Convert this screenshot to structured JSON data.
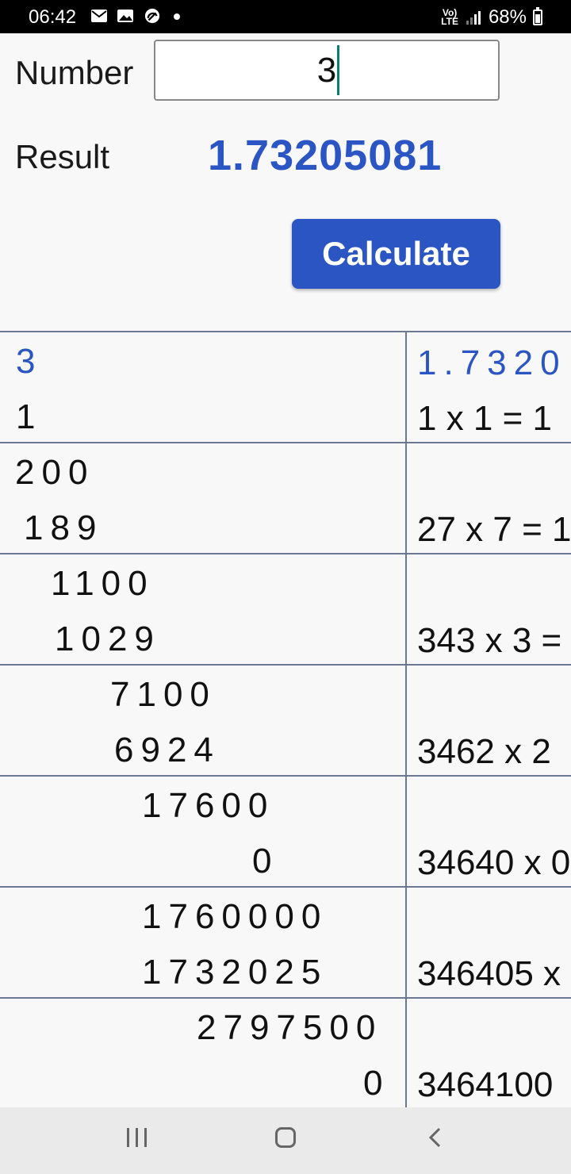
{
  "status_bar": {
    "time": "06:42",
    "icons": [
      "mail-icon",
      "image-icon",
      "sync-icon"
    ],
    "network": "Vo) LTE",
    "signal": "signal-icon",
    "battery": "68%",
    "battery_level": 0.68
  },
  "form": {
    "number_label": "Number",
    "number_value": "3",
    "result_label": "Result",
    "result_value": "1.73205081",
    "calculate_label": "Calculate"
  },
  "table": {
    "rows": [
      {
        "left_top": "3",
        "left_bottom": "1",
        "right_top": "1.7320",
        "right_bottom": "1 x 1 = 1"
      },
      {
        "left_top": "200",
        "left_bottom": "189",
        "right_top": "",
        "right_bottom": "27 x 7 = 1"
      },
      {
        "left_top": "1100",
        "left_bottom": "1029",
        "right_top": "",
        "right_bottom": "343 x 3 ="
      },
      {
        "left_top": "7100",
        "left_bottom": "6924",
        "right_top": "",
        "right_bottom": "3462 x 2"
      },
      {
        "left_top": "17600",
        "left_bottom": "0",
        "right_top": "",
        "right_bottom": "34640 x 0"
      },
      {
        "left_top": "1760000",
        "left_bottom": "1732025",
        "right_top": "",
        "right_bottom": "346405 x"
      },
      {
        "left_top": "2797500",
        "left_bottom": "0",
        "right_top": "",
        "right_bottom": "3464100"
      }
    ]
  },
  "nav": {
    "icons": [
      "recent-apps-icon",
      "home-icon",
      "back-icon"
    ]
  }
}
